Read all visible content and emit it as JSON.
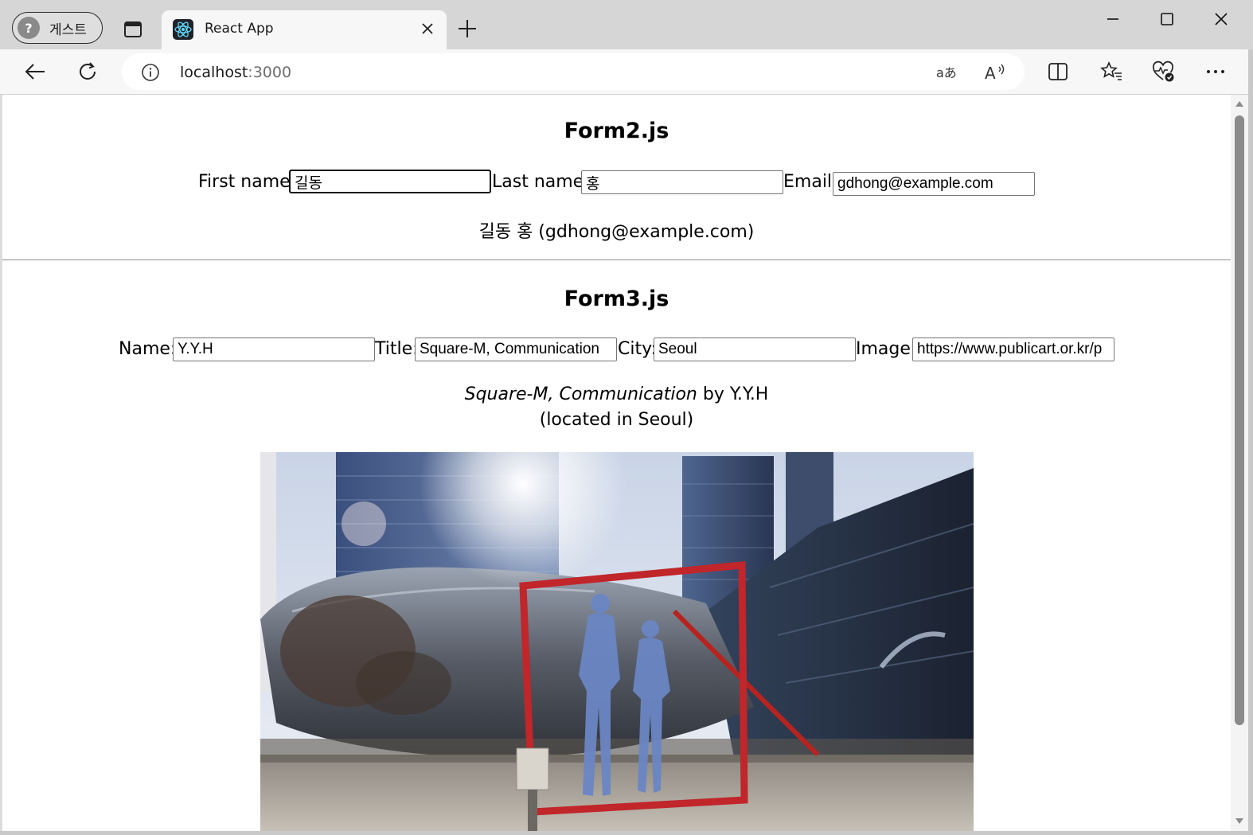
{
  "browser": {
    "profile_label": "게스트",
    "tab_title": "React App",
    "url_host": "localhost",
    "url_port": ":3000"
  },
  "form2": {
    "title": "Form2.js",
    "first_name_label": "First name:",
    "first_name_value": "길동",
    "last_name_label": "Last name:",
    "last_name_value": "홍",
    "email_label": "Email:",
    "email_value": "gdhong@example.com",
    "output": "길동 홍 (gdhong@example.com)"
  },
  "form3": {
    "title": "Form3.js",
    "name_label": "Name:",
    "name_value": "Y.Y.H",
    "title_label": "Title:",
    "title_value": "Square-M, Communication",
    "city_label": "City:",
    "city_value": "Seoul",
    "image_label": "Image:",
    "image_value": "https://www.publicart.or.kr/p",
    "output_title": "Square-M, Communication",
    "output_by": " by ",
    "output_author": "Y.Y.H",
    "output_location_prefix": "(located in ",
    "output_location_city": "Seoul",
    "output_location_suffix": ")"
  },
  "icons": {
    "profile": "profile-avatar-icon",
    "tabs": "tab-actions-icon",
    "favicon": "react-logo-icon",
    "close": "close-icon",
    "new_tab": "plus-icon",
    "minimize": "minimize-icon",
    "maximize": "maximize-icon",
    "window_close": "window-close-icon",
    "back": "back-arrow-icon",
    "refresh": "refresh-icon",
    "site_info": "info-icon",
    "translate": "translate-icon",
    "read_aloud": "read-aloud-icon",
    "split_screen": "split-screen-icon",
    "favorites": "favorites-icon",
    "browser_essentials": "heart-pulse-icon",
    "more": "more-dots-icon"
  }
}
